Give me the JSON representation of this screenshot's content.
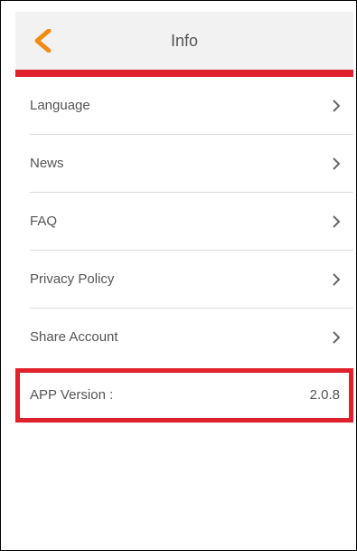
{
  "header": {
    "back_icon": "chevron-left-icon",
    "title": "Info"
  },
  "colors": {
    "accent": "#f08c16",
    "bar": "#e0202a",
    "text": "#555555",
    "chevron": "#666666"
  },
  "menu": {
    "items": [
      {
        "label": "Language",
        "icon": "chevron-right-icon"
      },
      {
        "label": "News",
        "icon": "chevron-right-icon"
      },
      {
        "label": "FAQ",
        "icon": "chevron-right-icon"
      },
      {
        "label": "Privacy Policy",
        "icon": "chevron-right-icon"
      },
      {
        "label": "Share Account",
        "icon": "chevron-right-icon"
      }
    ]
  },
  "version": {
    "label": "APP Version :",
    "value": "2.0.8"
  }
}
